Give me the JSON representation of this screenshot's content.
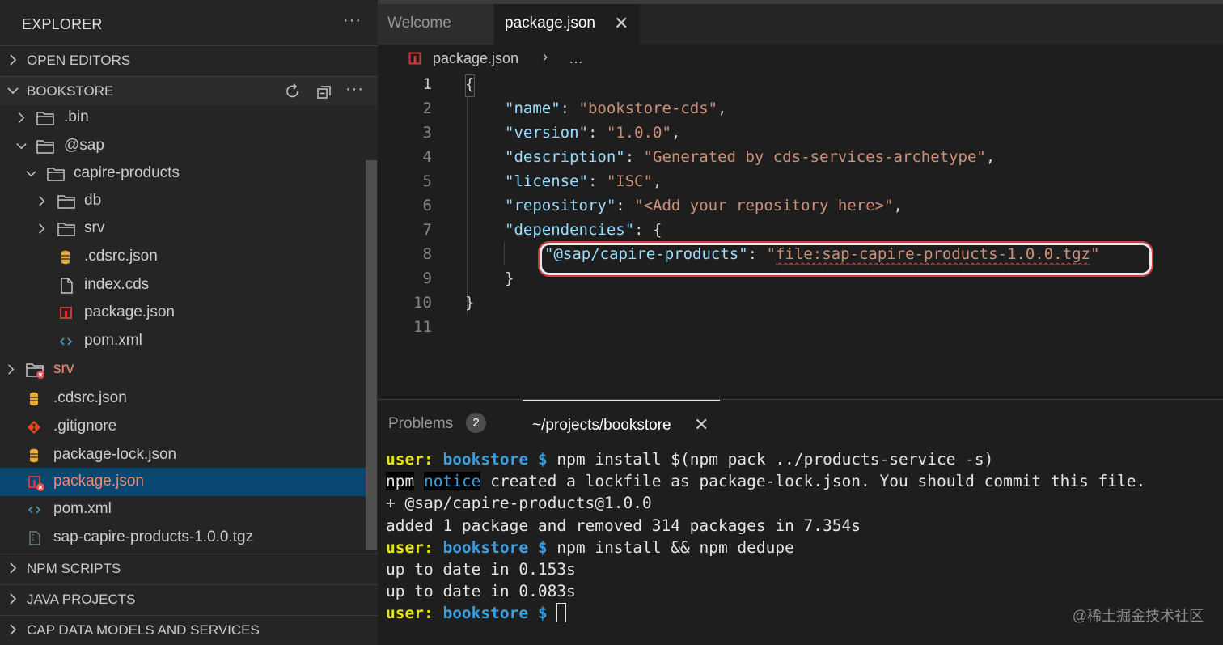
{
  "sidebar": {
    "title": "EXPLORER",
    "more": "···",
    "sections": {
      "open_editors": "OPEN EDITORS",
      "bookstore": "BOOKSTORE",
      "npm_scripts": "NPM SCRIPTS",
      "java_projects": "JAVA PROJECTS",
      "cap": "CAP DATA MODELS AND SERVICES"
    },
    "tree": [
      {
        "name": ".bin",
        "type": "folder",
        "expanded": false
      },
      {
        "name": "@sap",
        "type": "folder",
        "expanded": true
      },
      {
        "name": "capire-products",
        "type": "folder",
        "expanded": true
      },
      {
        "name": "db",
        "type": "folder",
        "expanded": false
      },
      {
        "name": "srv",
        "type": "folder",
        "expanded": false
      },
      {
        "name": ".cdsrc.json",
        "type": "json-config"
      },
      {
        "name": "index.cds",
        "type": "file"
      },
      {
        "name": "package.json",
        "type": "npm"
      },
      {
        "name": "pom.xml",
        "type": "xml"
      },
      {
        "name": "srv",
        "type": "folder",
        "expanded": false,
        "error": true
      },
      {
        "name": ".cdsrc.json",
        "type": "json-config"
      },
      {
        "name": ".gitignore",
        "type": "git"
      },
      {
        "name": "package-lock.json",
        "type": "json-config"
      },
      {
        "name": "package.json",
        "type": "npm",
        "error": true,
        "selected": true
      },
      {
        "name": "pom.xml",
        "type": "xml"
      },
      {
        "name": "sap-capire-products-1.0.0.tgz",
        "type": "archive"
      }
    ]
  },
  "tabs": {
    "welcome": "Welcome",
    "package": "package.json",
    "close": "✕"
  },
  "breadcrumb": {
    "file": "package.json",
    "separator": "›",
    "more": "…"
  },
  "editor": {
    "line_numbers": [
      "1",
      "2",
      "3",
      "4",
      "5",
      "6",
      "7",
      "8",
      "9",
      "10",
      "11"
    ],
    "lines": {
      "l1": "{",
      "l2_key": "\"name\"",
      "l2_val": "\"bookstore-cds\"",
      "l3_key": "\"version\"",
      "l3_val": "\"1.0.0\"",
      "l4_key": "\"description\"",
      "l4_val": "\"Generated by cds-services-archetype\"",
      "l5_key": "\"license\"",
      "l5_val": "\"ISC\"",
      "l6_key": "\"repository\"",
      "l6_val": "\"<Add your repository here>\"",
      "l7_key": "\"dependencies\"",
      "l7_rest": ": {",
      "l8_key": "\"@sap/capire-products\"",
      "l8_val_q1": "\"",
      "l8_val": "file:sap-capire-products-1.0.0.tgz",
      "l8_val_q2": "\"",
      "l9": "}",
      "l10": "}",
      "colon": ": ",
      "comma": ","
    }
  },
  "panel": {
    "problems_label": "Problems",
    "problems_count": "2",
    "terminal_label": "~/projects/bookstore",
    "close": "✕"
  },
  "terminal": {
    "user": "user:",
    "dir": "bookstore",
    "dollar": "$",
    "cmd1": " npm install $(npm pack ../products-service -s)",
    "npm": "npm",
    "notice": "notice",
    "line2_rest": " created a lockfile as package-lock.json. You should commit this file.",
    "line3": "+ @sap/capire-products@1.0.0",
    "line4": "added 1 package and removed 314 packages in 7.354s",
    "cmd2": " npm install && npm dedupe",
    "line6": "up to date in 0.153s",
    "line7": "up to date in 0.083s"
  },
  "watermark": "@稀土掘金技术社区",
  "colors": {
    "accent_selection": "#094771",
    "error": "#f48771",
    "json_key": "#9cdcfe",
    "json_string": "#ce9178",
    "highlight_ring": "#d23c3c"
  }
}
